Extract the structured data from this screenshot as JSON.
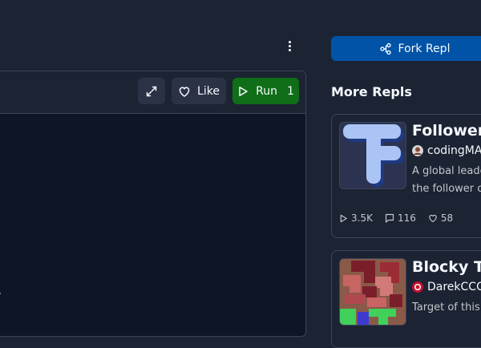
{
  "toolbar": {
    "like_label": "Like",
    "run_label": "Run",
    "run_count": "1"
  },
  "sidebar": {
    "fork_label": "Fork Repl",
    "more_title": "More Repls",
    "repls": [
      {
        "title": "Follower T",
        "author": "codingMAS",
        "desc_line1": "A global leade",
        "desc_line2": "the follower c",
        "runs": "3.5K",
        "comments": "116",
        "likes": "58"
      },
      {
        "title": "Blocky To",
        "author": "DarekCCC",
        "desc_line1": "Target of this g",
        "desc_line2": ""
      }
    ]
  },
  "colors": {
    "background": "#1c2333",
    "player_bg": "#0e1525",
    "run_green": "#0f6e17",
    "fork_blue": "#0053a6",
    "border": "#3c445c"
  }
}
